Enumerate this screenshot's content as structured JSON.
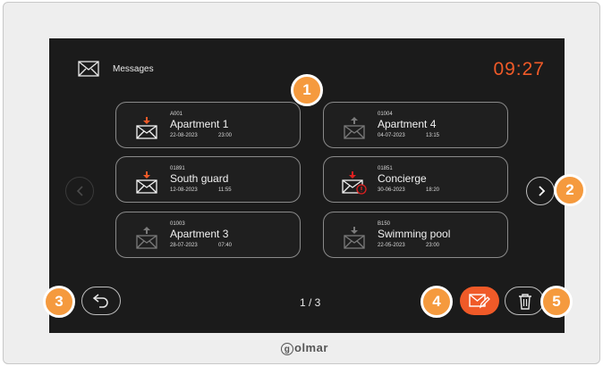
{
  "header": {
    "title": "Messages",
    "time": "09:27"
  },
  "messages": [
    {
      "code": "A001",
      "name": "Apartment 1",
      "date": "22-08-2023",
      "time": "23:00",
      "status": "unread"
    },
    {
      "code": "01004",
      "name": "Apartment 4",
      "date": "04-07-2023",
      "time": "13:15",
      "status": "read"
    },
    {
      "code": "01891",
      "name": "South guard",
      "date": "12-08-2023",
      "time": "11:55",
      "status": "unread"
    },
    {
      "code": "01851",
      "name": "Concierge",
      "date": "30-06-2023",
      "time": "18:20",
      "status": "alert"
    },
    {
      "code": "01003",
      "name": "Apartment 3",
      "date": "28-07-2023",
      "time": "07:40",
      "status": "read"
    },
    {
      "code": "B150",
      "name": "Swimming pool",
      "date": "22-05-2023",
      "time": "23:00",
      "status": "read"
    }
  ],
  "pagination": {
    "label": "1 / 3"
  },
  "callouts": [
    "1",
    "2",
    "3",
    "4",
    "5"
  ],
  "brand": {
    "name": "olmar",
    "initial": "g"
  },
  "colors": {
    "accent": "#f05a28",
    "callout": "#f59a3e",
    "screen_bg": "#1b1b1b",
    "alert": "#e02020"
  },
  "icons": {
    "header": "envelope-icon",
    "unread": "envelope-arrow-down-icon",
    "read": "envelope-arrow-up-icon",
    "alert": "envelope-alert-icon",
    "prev": "chevron-left-icon",
    "next": "chevron-right-icon",
    "back": "return-arrow-icon",
    "new": "envelope-edit-icon",
    "delete": "trash-icon"
  }
}
